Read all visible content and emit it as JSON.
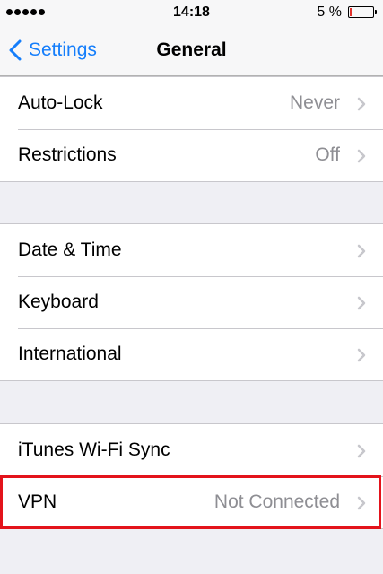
{
  "status_bar": {
    "time": "14:18",
    "battery_percent": "5 %",
    "battery_level": 0.05,
    "signal_bars": 5,
    "battery_color": "#e0322c"
  },
  "nav": {
    "back_label": "Settings",
    "title": "General",
    "accent_color": "#157efb"
  },
  "groups": [
    {
      "rows": [
        {
          "label": "Auto-Lock",
          "value": "Never"
        },
        {
          "label": "Restrictions",
          "value": "Off"
        }
      ]
    },
    {
      "rows": [
        {
          "label": "Date & Time"
        },
        {
          "label": "Keyboard"
        },
        {
          "label": "International"
        }
      ]
    },
    {
      "rows": [
        {
          "label": "iTunes Wi-Fi Sync"
        },
        {
          "label": "VPN",
          "value": "Not Connected",
          "highlighted": true
        }
      ]
    }
  ],
  "highlight_color": "#e3131b"
}
